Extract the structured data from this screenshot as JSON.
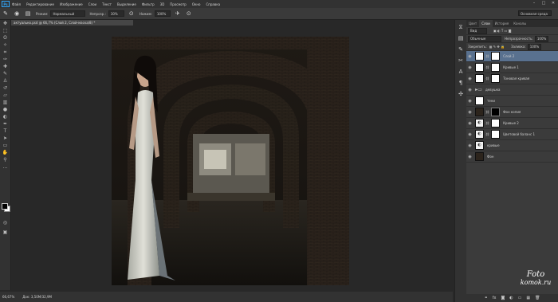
{
  "app": {
    "logo": "Ps"
  },
  "menu": [
    "Файл",
    "Редактирование",
    "Изображение",
    "Слои",
    "Текст",
    "Выделение",
    "Фильтр",
    "3D",
    "Просмотр",
    "Окно",
    "Справка"
  ],
  "window_controls": [
    "–",
    "□",
    "✕"
  ],
  "options": {
    "mode_label": "Режим:",
    "mode_value": "Нормальный",
    "opacity_label": "Непрозр.:",
    "opacity_value": "30%",
    "flow_label": "Нажим:",
    "flow_value": "100%",
    "workspace": "Основная среда"
  },
  "document": {
    "tab": "актуально.psd @ 66,7% (Слой 2, Слой-маска/8) *"
  },
  "status": {
    "zoom": "66,67%",
    "doc": "Док: 3,50M/32,9M"
  },
  "panel": {
    "tabs": [
      "Цвет",
      "Слои",
      "История",
      "Каналы"
    ],
    "kind_filter": "Вид",
    "blend_mode": "Обычные",
    "opacity_label": "Непрозрачность:",
    "opacity_value": "100%",
    "lock_label": "Закрепить:",
    "fill_label": "Заливка:",
    "fill_value": "100%",
    "layers": [
      {
        "name": "Слой 2",
        "thumb": "white",
        "mask": "white",
        "selected": true
      },
      {
        "name": "Кривые 1",
        "thumb": "white",
        "mask": "white",
        "selected": false
      },
      {
        "name": "Тоновая кривая",
        "thumb": "white",
        "mask": "white",
        "selected": false
      },
      {
        "name": "девушка",
        "thumb": "folder",
        "mask": "",
        "selected": false
      },
      {
        "name": "тени",
        "thumb": "white",
        "mask": "",
        "selected": false
      },
      {
        "name": "Фон копия",
        "thumb": "dark",
        "mask": "black",
        "selected": false
      },
      {
        "name": "Кривые 2",
        "thumb": "adj",
        "mask": "white",
        "selected": false
      },
      {
        "name": "Цветовой баланс 1",
        "thumb": "adj",
        "mask": "white",
        "selected": false
      },
      {
        "name": "кривые",
        "thumb": "adj",
        "mask": "",
        "selected": false
      },
      {
        "name": "Фон",
        "thumb": "dark",
        "mask": "",
        "selected": false
      }
    ],
    "footer_icons": [
      "⚭",
      "fx",
      "◙",
      "◐",
      "▭",
      "▦",
      "🗑"
    ]
  },
  "watermark": {
    "line1": "Foto",
    "line2": "komok.ru"
  },
  "colors": {
    "accent": "#31a8ff",
    "selected_layer": "#59718f"
  }
}
